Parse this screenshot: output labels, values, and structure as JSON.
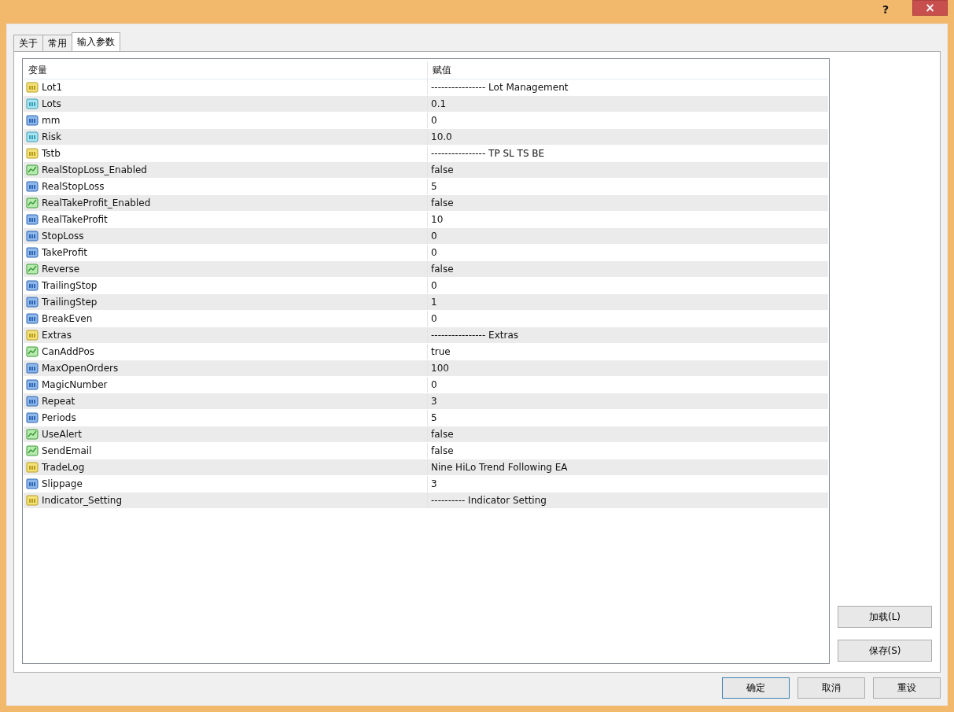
{
  "title_bar": {
    "help": "?",
    "close": "×"
  },
  "tabs": [
    {
      "label": "关于",
      "selected": false
    },
    {
      "label": "常用",
      "selected": false
    },
    {
      "label": "输入参数",
      "selected": true
    }
  ],
  "table": {
    "columns": [
      "变量",
      "赋值"
    ],
    "rows": [
      {
        "kind": "string",
        "name": "Lot1",
        "value": "---------------- Lot Management"
      },
      {
        "kind": "double",
        "name": "Lots",
        "value": "0.1"
      },
      {
        "kind": "int",
        "name": "mm",
        "value": "0"
      },
      {
        "kind": "double",
        "name": "Risk",
        "value": "10.0"
      },
      {
        "kind": "string",
        "name": "Tstb",
        "value": "---------------- TP SL TS BE"
      },
      {
        "kind": "bool",
        "name": "RealStopLoss_Enabled",
        "value": "false"
      },
      {
        "kind": "int",
        "name": "RealStopLoss",
        "value": "5"
      },
      {
        "kind": "bool",
        "name": "RealTakeProfit_Enabled",
        "value": "false"
      },
      {
        "kind": "int",
        "name": "RealTakeProfit",
        "value": "10"
      },
      {
        "kind": "int",
        "name": "StopLoss",
        "value": "0"
      },
      {
        "kind": "int",
        "name": "TakeProfit",
        "value": "0"
      },
      {
        "kind": "bool",
        "name": "Reverse",
        "value": "false"
      },
      {
        "kind": "int",
        "name": "TrailingStop",
        "value": "0"
      },
      {
        "kind": "int",
        "name": "TrailingStep",
        "value": "1"
      },
      {
        "kind": "int",
        "name": "BreakEven",
        "value": "0"
      },
      {
        "kind": "string",
        "name": "Extras",
        "value": "---------------- Extras"
      },
      {
        "kind": "bool",
        "name": "CanAddPos",
        "value": "true"
      },
      {
        "kind": "int",
        "name": "MaxOpenOrders",
        "value": "100"
      },
      {
        "kind": "int",
        "name": "MagicNumber",
        "value": "0"
      },
      {
        "kind": "int",
        "name": "Repeat",
        "value": "3"
      },
      {
        "kind": "int",
        "name": "Periods",
        "value": "5"
      },
      {
        "kind": "bool",
        "name": "UseAlert",
        "value": "false"
      },
      {
        "kind": "bool",
        "name": "SendEmail",
        "value": "false"
      },
      {
        "kind": "string",
        "name": "TradeLog",
        "value": "Nine HiLo Trend Following EA"
      },
      {
        "kind": "int",
        "name": "Slippage",
        "value": "3"
      },
      {
        "kind": "string",
        "name": "Indicator_Setting",
        "value": "---------- Indicator Setting"
      }
    ]
  },
  "side_buttons": [
    "加载(L)",
    "保存(S)"
  ],
  "buttons": [
    "确定",
    "取消",
    "重设"
  ]
}
